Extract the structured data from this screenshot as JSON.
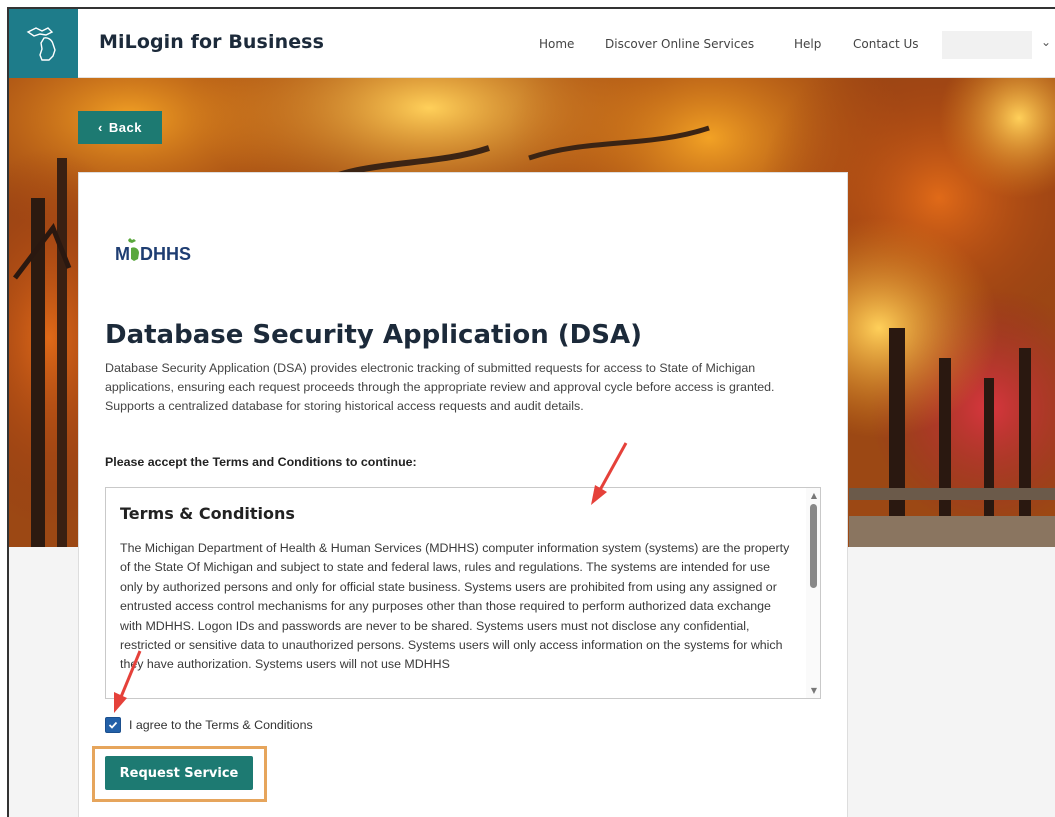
{
  "header": {
    "brand": "MiLogin for Business",
    "nav": {
      "home": "Home",
      "discover": "Discover Online Services",
      "help": "Help",
      "contact": "Contact Us"
    },
    "user_chevron": "⌄"
  },
  "back_button": {
    "label": "Back",
    "icon": "‹"
  },
  "department_logo": "MDHHS",
  "page": {
    "title": "Database Security Application (DSA)",
    "description": "Database Security Application (DSA) provides electronic tracking of submitted requests for access to State of Michigan applications, ensuring each request proceeds through the appropriate review and approval cycle before access is granted. Supports a centralized database for storing historical access requests and audit details.",
    "prompt": "Please accept the Terms and Conditions to continue:"
  },
  "terms": {
    "title": "Terms & Conditions",
    "body": "The Michigan Department of Health & Human Services (MDHHS) computer information system (systems) are the property of the State Of Michigan and subject to state and federal laws, rules and regulations. The systems are intended for use only by authorized persons and only for official state business. Systems users are prohibited from using any assigned or entrusted access control mechanisms for any purposes other than those required to perform authorized data exchange with MDHHS. Logon IDs and passwords are never to be shared. Systems users must not disclose any confidential, restricted or sensitive data to unauthorized persons. Systems users will only access information on the systems for which they have authorization. Systems users will not use MDHHS"
  },
  "agree": {
    "label": "I agree to the Terms & Conditions",
    "checked": true
  },
  "request_button": {
    "label": "Request Service"
  },
  "colors": {
    "accent": "#1d7a72",
    "header_logo_bg": "#1e7c8a",
    "annotation_arrow": "#e5413a",
    "annotation_box": "#e6a55c"
  }
}
